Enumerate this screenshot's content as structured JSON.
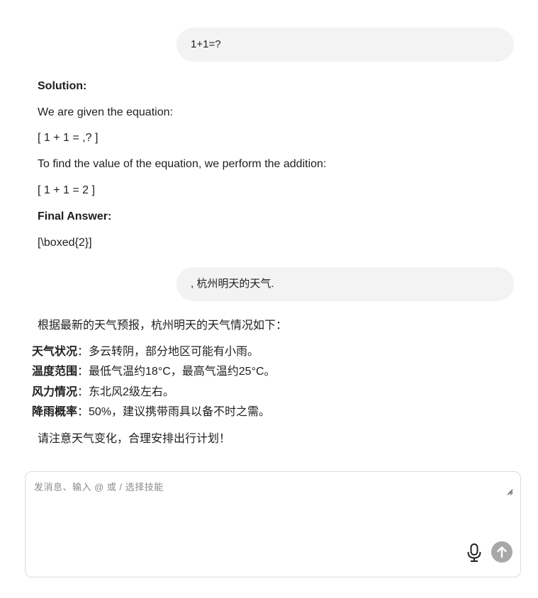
{
  "conversation": {
    "user_message_1": "1+1=?",
    "assistant_reply_1": {
      "solution_heading": "Solution:",
      "given_text": "We are given the equation:",
      "equation": "[ 1 + 1 = ,? ]",
      "method_text": "To find the value of the equation, we perform the addition:",
      "result": "[ 1 + 1 = 2 ]",
      "final_heading": "Final Answer:",
      "final_value": "[\\boxed{2}]"
    },
    "user_message_2": ", 杭州明天的天气.",
    "assistant_reply_2": {
      "intro": "根据最新的天气预报，杭州明天的天气情况如下：",
      "items": [
        {
          "label": "天气状况",
          "value": "：多云转阴，部分地区可能有小雨。"
        },
        {
          "label": "温度范围",
          "value": "：最低气温约18°C，最高气温约25°C。"
        },
        {
          "label": "风力情况",
          "value": "：东北风2级左右。"
        },
        {
          "label": "降雨概率",
          "value": "：50%，建议携带雨具以备不时之需。"
        }
      ],
      "closing": "请注意天气变化，合理安排出行计划！"
    }
  },
  "composer": {
    "placeholder": "发消息、输入 @ 或 / 选择技能",
    "mic_icon": "microphone-icon",
    "send_icon": "arrow-up-icon",
    "send_color": "#a8a8a8"
  }
}
